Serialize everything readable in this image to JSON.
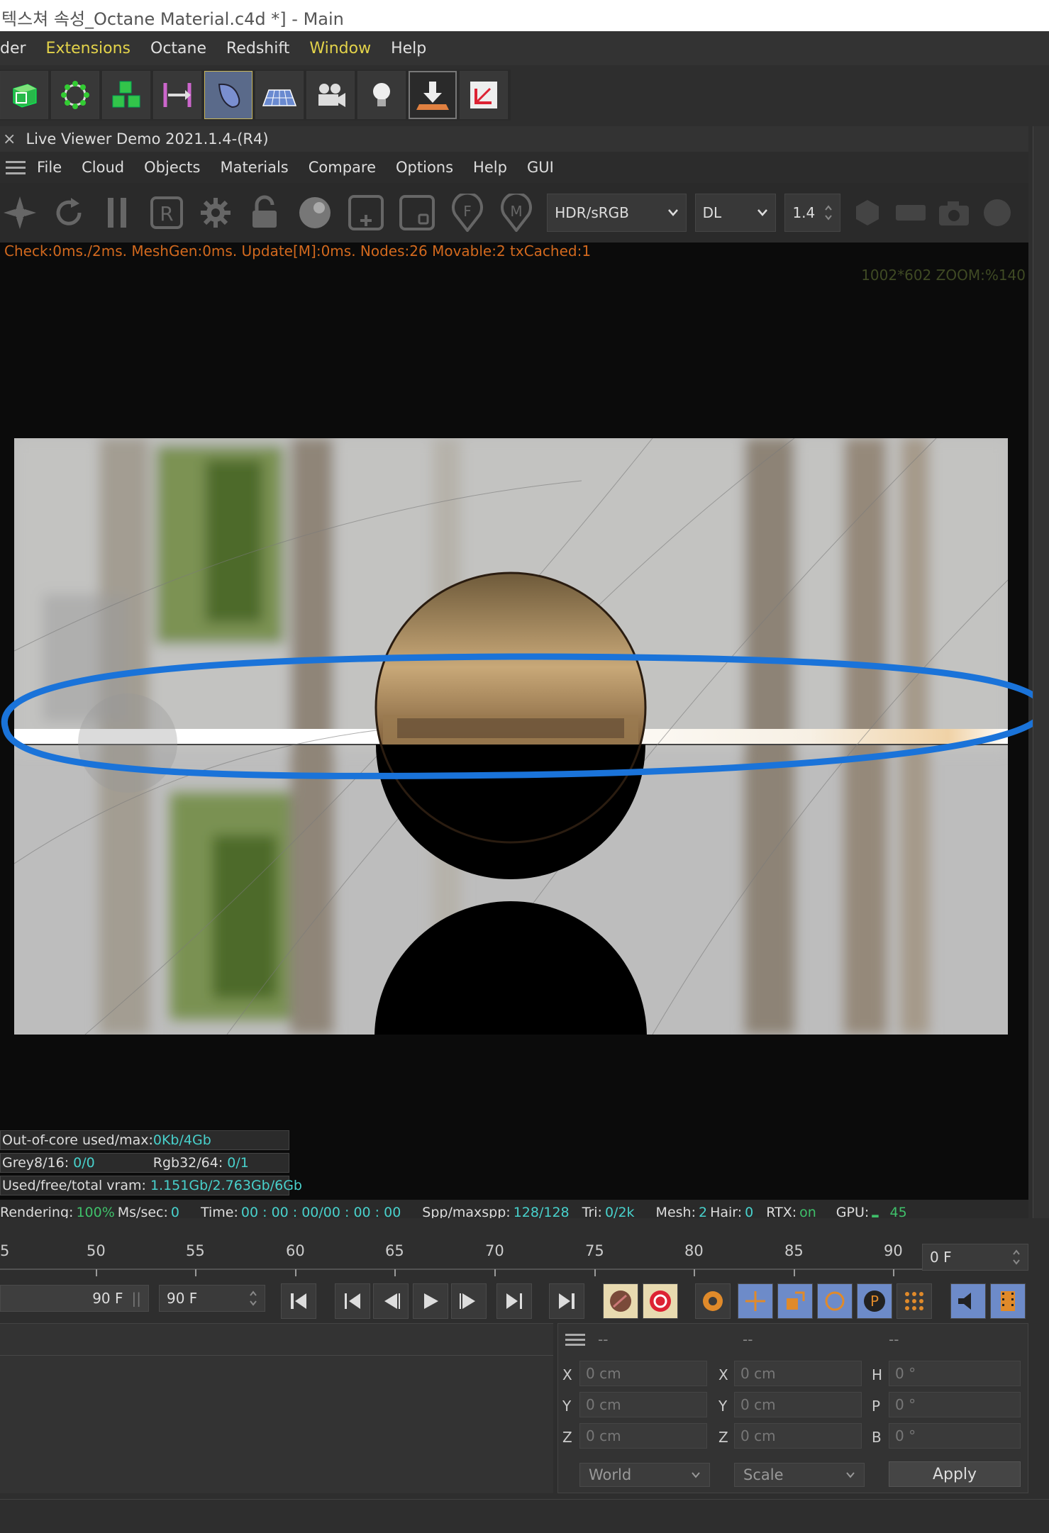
{
  "window": {
    "title": "텍스쳐 속성_Octane Material.c4d *] - Main"
  },
  "menubar": {
    "items": [
      {
        "label": "der",
        "highlight": false
      },
      {
        "label": "Extensions",
        "highlight": true
      },
      {
        "label": "Octane",
        "highlight": false
      },
      {
        "label": "Redshift",
        "highlight": false
      },
      {
        "label": "Window",
        "highlight": true
      },
      {
        "label": "Help",
        "highlight": false
      }
    ]
  },
  "toolbar": {
    "icons": [
      "cube-icon",
      "subdivision-icon",
      "cubes-array-icon",
      "symmetry-icon",
      "deformer-icon",
      "floor-icon",
      "camera-icon",
      "light-icon",
      "download-icon",
      "coordinate-icon"
    ]
  },
  "live_viewer": {
    "title": "Live Viewer Demo 2021.1.4-(R4)",
    "close": "×",
    "menu": [
      "File",
      "Cloud",
      "Objects",
      "Materials",
      "Compare",
      "Options",
      "Help",
      "GUI"
    ],
    "color_space": "HDR/sRGB",
    "kernel": "DL",
    "gamma": "1.4",
    "status": "Check:0ms./2ms. MeshGen:0ms. Update[M]:0ms. Nodes:26 Movable:2 txCached:1",
    "zoom_info": "1002*602 ZOOM:%140",
    "stats": {
      "out_of_core_label": "Out-of-core used/max:",
      "out_of_core_value": "0Kb/4Gb",
      "grey_label": "Grey8/16:",
      "grey_value": "0/0",
      "rgb_label": "Rgb32/64:",
      "rgb_value": "0/1",
      "vram_label": "Used/free/total vram:",
      "vram_value": "1.151Gb/2.763Gb/6Gb"
    },
    "render_bar": {
      "rendering_label": "Rendering:",
      "rendering_value": "100%",
      "ms_label": "Ms/sec:",
      "ms_value": "0",
      "time_label": "Time:",
      "time_value": "00 : 00 : 00/00 : 00 : 00",
      "spp_label": "Spp/maxspp:",
      "spp_value": "128/128",
      "tri_label": "Tri:",
      "tri_value": "0/2k",
      "mesh_label": "Mesh:",
      "mesh_value": "2",
      "hair_label": "Hair:",
      "hair_value": "0",
      "rtx_label": "RTX:",
      "rtx_value": "on",
      "gpu_label": "GPU:",
      "gpu_value": "45"
    }
  },
  "timeline": {
    "ticks": [
      "5",
      "50",
      "55",
      "60",
      "65",
      "70",
      "75",
      "80",
      "85",
      "90"
    ],
    "current_frame": "0 F",
    "end_frame": "90 F",
    "max_frame": "90 F"
  },
  "coordinates": {
    "headers": [
      "--",
      "--",
      "--"
    ],
    "rows": [
      {
        "a": "X",
        "av": "0 cm",
        "b": "X",
        "bv": "0 cm",
        "c": "H",
        "cv": "0 °"
      },
      {
        "a": "Y",
        "av": "0 cm",
        "b": "Y",
        "bv": "0 cm",
        "c": "P",
        "cv": "0 °"
      },
      {
        "a": "Z",
        "av": "0 cm",
        "b": "Z",
        "bv": "0 cm",
        "c": "B",
        "cv": "0 °"
      }
    ],
    "space": "World",
    "mode": "Scale",
    "apply": "Apply"
  },
  "colors": {
    "accent_yellow": "#e3d34a",
    "status_orange": "#d2691e",
    "cyan": "#48d1cc",
    "annotation_blue": "#1a73d9"
  }
}
